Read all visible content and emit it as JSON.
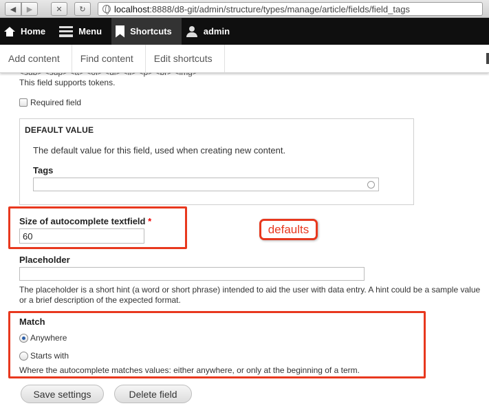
{
  "browser": {
    "url_host": "localhost",
    "url_path": ":8888/d8-git/admin/structure/types/manage/article/fields/field_tags"
  },
  "toolbar": {
    "home": "Home",
    "menu": "Menu",
    "shortcuts": "Shortcuts",
    "user": "admin"
  },
  "tray": {
    "links": [
      "Add content",
      "Find content",
      "Edit shortcuts"
    ]
  },
  "content": {
    "cut_tags": "<sub> <sup> <tt> <ol> <ul> <li> <p> <br> <img>",
    "tokens_note": "This field supports tokens.",
    "required_label": "Required field",
    "default_value": {
      "legend": "DEFAULT VALUE",
      "description": "The default value for this field, used when creating new content.",
      "tags_label": "Tags",
      "tags_value": ""
    },
    "size": {
      "label": "Size of autocomplete textfield",
      "required_marker": "*",
      "value": "60"
    },
    "callout": "defaults",
    "placeholder": {
      "label": "Placeholder",
      "value": "",
      "description": "The placeholder is a short hint (a word or short phrase) intended to aid the user with data entry. A hint could be a sample value or a brief description of the expected format."
    },
    "match": {
      "label": "Match",
      "options": [
        "Anywhere",
        "Starts with"
      ],
      "selected": "Anywhere",
      "description": "Where the autocomplete matches values: either anywhere, or only at the beginning of a term."
    },
    "buttons": {
      "save": "Save settings",
      "delete": "Delete field"
    }
  },
  "colors": {
    "annotation": "#e8381e",
    "toolbar_bg": "#0f0f0f",
    "radio_selected": "#2b5fa8"
  }
}
